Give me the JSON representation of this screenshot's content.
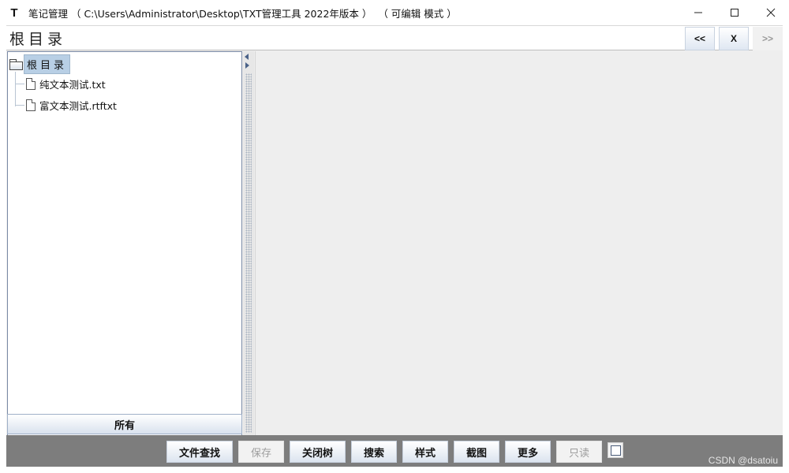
{
  "titlebar": {
    "app_icon": "T",
    "title": "笔记管理 （ C:\\Users\\Administrator\\Desktop\\TXT管理工具 2022年版本 ）  （ 可编辑 模式 ）",
    "controls": {
      "minimize": "minimize-icon",
      "maximize": "maximize-icon",
      "close": "close-icon"
    }
  },
  "pathbar": {
    "path": "根目录",
    "back_label": "<<",
    "clear_label": "X",
    "forward_label": ">>"
  },
  "tree": {
    "root_label": "根目录",
    "items": [
      {
        "label": "纯文本测试.txt",
        "icon": "file-icon"
      },
      {
        "label": "富文本测试.rtftxt",
        "icon": "file-icon"
      }
    ],
    "filter_button": "所有"
  },
  "toolbar": {
    "find_file": "文件查找",
    "save": "保存",
    "close_tree": "关闭树",
    "search": "搜索",
    "style": "样式",
    "screenshot": "截图",
    "more": "更多",
    "readonly": "只读",
    "readonly_checked": false
  },
  "watermark": "CSDN @dsatoiu",
  "colors": {
    "selection": "#b8cfe5",
    "toolbar_background": "#7d7d7d",
    "content_background": "#eeeeee"
  }
}
